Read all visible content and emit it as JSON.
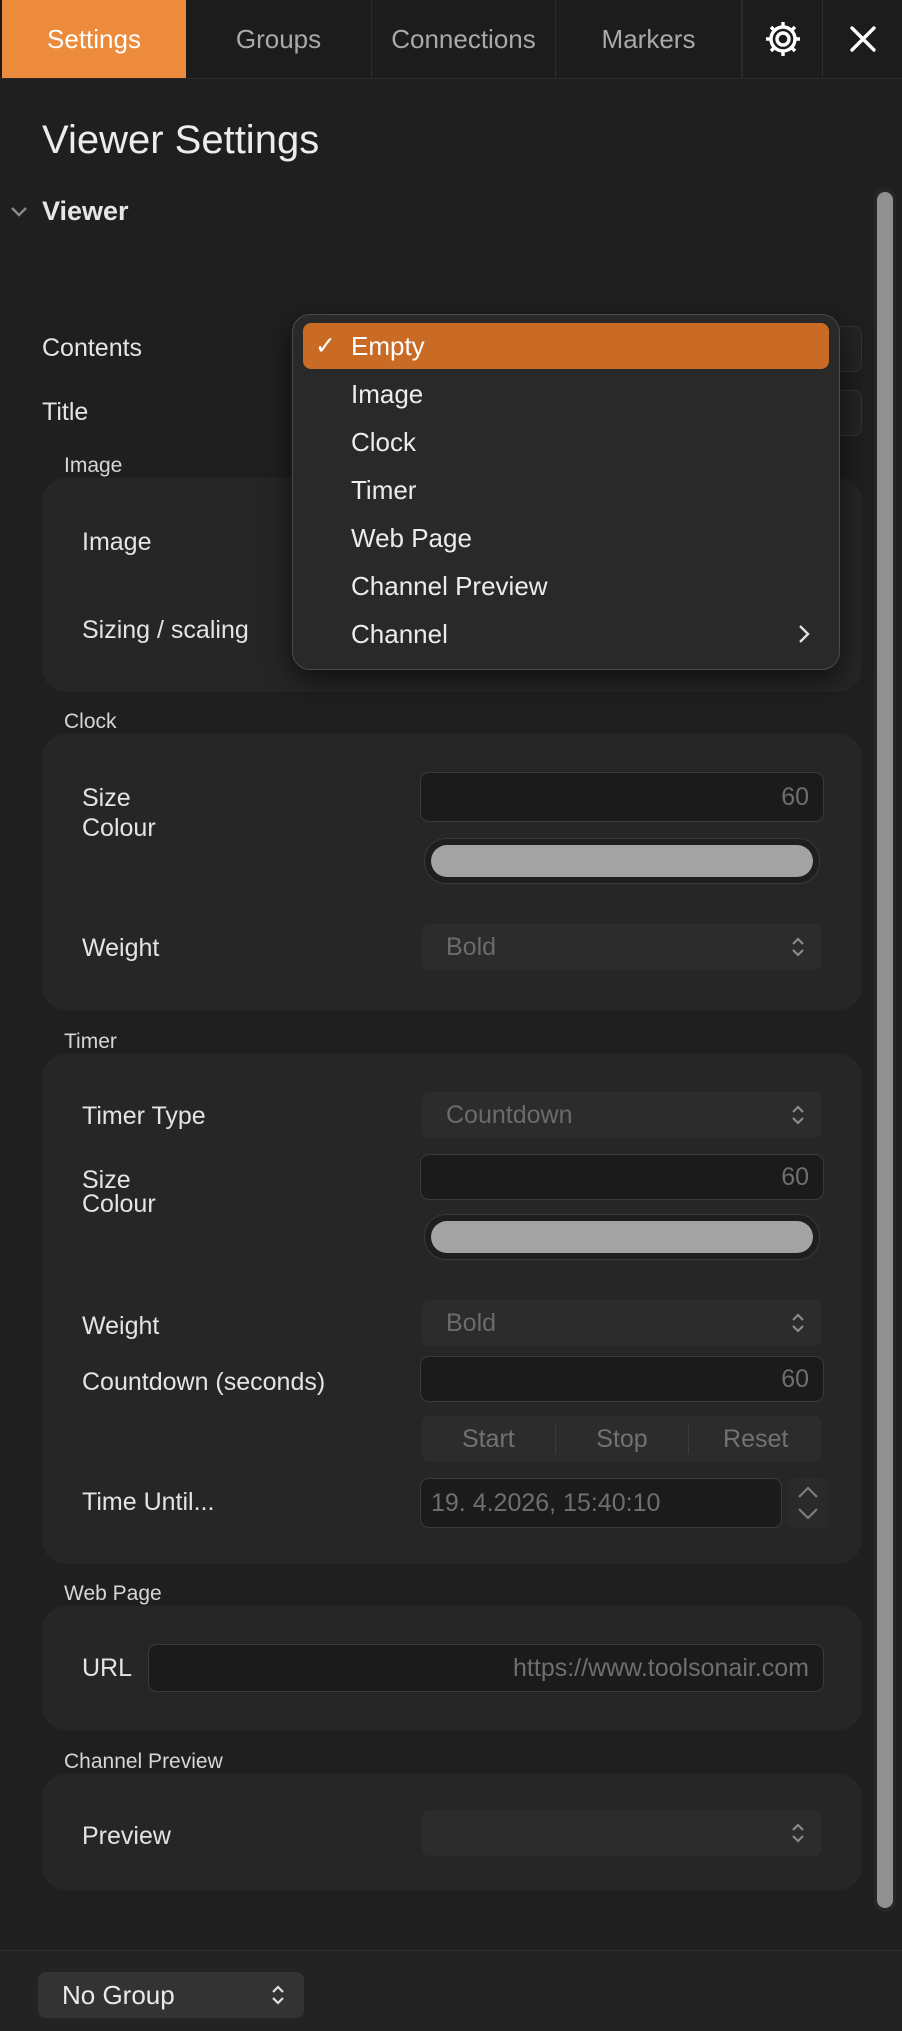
{
  "tabs": [
    {
      "label": "Settings"
    },
    {
      "label": "Groups"
    },
    {
      "label": "Connections"
    },
    {
      "label": "Markers"
    }
  ],
  "page_title": "Viewer Settings",
  "section": {
    "label": "Viewer"
  },
  "viewer": {
    "contents_label": "Contents",
    "title_label": "Title"
  },
  "image_group": {
    "heading": "Image",
    "image_label": "Image",
    "sizing_label": "Sizing / scaling"
  },
  "clock_group": {
    "heading": "Clock",
    "size_label": "Size",
    "size_value": "60",
    "colour_label": "Colour",
    "colour_value": "#a3a3a3",
    "weight_label": "Weight",
    "weight_value": "Bold"
  },
  "timer_group": {
    "heading": "Timer",
    "type_label": "Timer Type",
    "type_value": "Countdown",
    "size_label": "Size",
    "size_value": "60",
    "colour_label": "Colour",
    "colour_value": "#a3a3a3",
    "weight_label": "Weight",
    "weight_value": "Bold",
    "countdown_label": "Countdown (seconds)",
    "countdown_value": "60",
    "buttons": {
      "start": "Start",
      "stop": "Stop",
      "reset": "Reset"
    },
    "time_until_label": "Time Until...",
    "time_until_value": "19.  4.2026, 15:40:10"
  },
  "web_group": {
    "heading": "Web Page",
    "url_label": "URL",
    "url_value": "https://www.toolsonair.com"
  },
  "channel_preview_group": {
    "heading": "Channel Preview",
    "preview_label": "Preview",
    "preview_value": ""
  },
  "footer": {
    "group_value": "No Group"
  },
  "dropdown": {
    "selected_check": "✓",
    "items": [
      {
        "label": "Empty"
      },
      {
        "label": "Image"
      },
      {
        "label": "Clock"
      },
      {
        "label": "Timer"
      },
      {
        "label": "Web Page"
      },
      {
        "label": "Channel Preview"
      },
      {
        "label": "Channel"
      }
    ]
  },
  "colors": {
    "accent": "#ec8b3b",
    "menu_selected": "#c96b25"
  },
  "icons": [
    "gear-icon",
    "close-icon",
    "chevron-down-icon",
    "up-down-arrows-icon",
    "chevron-right-icon",
    "checkmark-icon"
  ]
}
